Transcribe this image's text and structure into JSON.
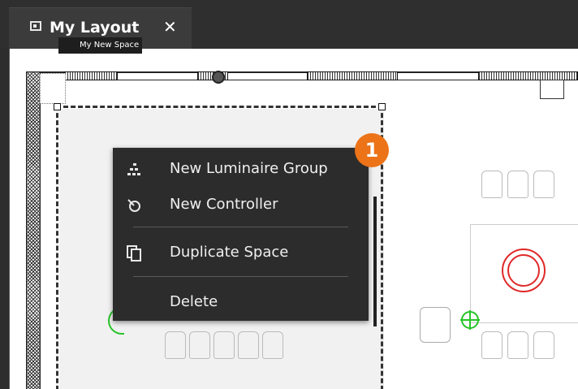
{
  "tab": {
    "icon": "layout-icon",
    "title": "My Layout",
    "close_label": "✕"
  },
  "space": {
    "label": "My New Space",
    "icon": "space-icon"
  },
  "context_menu": {
    "items": [
      {
        "label": "New Luminaire Group",
        "icon": "luminaire-group-icon"
      },
      {
        "label": "New Controller",
        "icon": "controller-icon"
      },
      {
        "label": "Duplicate Space",
        "icon": "duplicate-icon"
      },
      {
        "label": "Delete",
        "icon": ""
      }
    ]
  },
  "step_badge": "1",
  "colors": {
    "accent": "#ec7318",
    "space_label_icon": "#e8601c",
    "menu_bg": "#2c2c2c",
    "target": "#e02828",
    "crosshair": "#27c427"
  }
}
